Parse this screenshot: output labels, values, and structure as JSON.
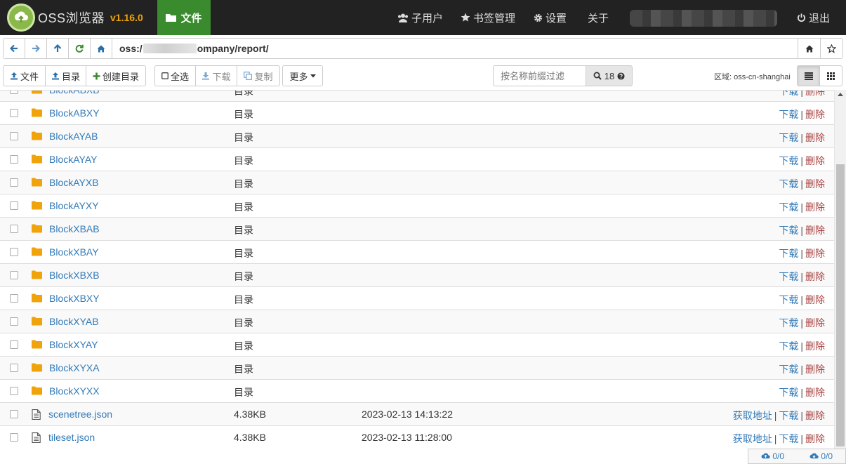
{
  "app": {
    "name": "OSS浏览器",
    "version": "v1.16.0"
  },
  "nav": {
    "files": "文件",
    "subusers": "子用户",
    "bookmarks": "书签管理",
    "settings": "设置",
    "about": "关于",
    "logout": "退出"
  },
  "address": {
    "prefix": "oss:/",
    "suffix": "ompany/report/"
  },
  "toolbar": {
    "upload_file": "文件",
    "upload_dir": "目录",
    "create_dir": "创建目录",
    "select_all": "全选",
    "download": "下载",
    "copy": "复制",
    "more": "更多",
    "filter_placeholder": "按名称前缀过滤",
    "count": "18",
    "region_label": "区域: oss-cn-shanghai"
  },
  "actions": {
    "get_url": "获取地址",
    "download": "下载",
    "delete": "删除"
  },
  "rows": [
    {
      "name": "BlockABXB",
      "kind": "dir",
      "type": "目录",
      "date": ""
    },
    {
      "name": "BlockABXY",
      "kind": "dir",
      "type": "目录",
      "date": ""
    },
    {
      "name": "BlockAYAB",
      "kind": "dir",
      "type": "目录",
      "date": ""
    },
    {
      "name": "BlockAYAY",
      "kind": "dir",
      "type": "目录",
      "date": ""
    },
    {
      "name": "BlockAYXB",
      "kind": "dir",
      "type": "目录",
      "date": ""
    },
    {
      "name": "BlockAYXY",
      "kind": "dir",
      "type": "目录",
      "date": ""
    },
    {
      "name": "BlockXBAB",
      "kind": "dir",
      "type": "目录",
      "date": ""
    },
    {
      "name": "BlockXBAY",
      "kind": "dir",
      "type": "目录",
      "date": ""
    },
    {
      "name": "BlockXBXB",
      "kind": "dir",
      "type": "目录",
      "date": ""
    },
    {
      "name": "BlockXBXY",
      "kind": "dir",
      "type": "目录",
      "date": ""
    },
    {
      "name": "BlockXYAB",
      "kind": "dir",
      "type": "目录",
      "date": ""
    },
    {
      "name": "BlockXYAY",
      "kind": "dir",
      "type": "目录",
      "date": ""
    },
    {
      "name": "BlockXYXA",
      "kind": "dir",
      "type": "目录",
      "date": ""
    },
    {
      "name": "BlockXYXX",
      "kind": "dir",
      "type": "目录",
      "date": ""
    },
    {
      "name": "scenetree.json",
      "kind": "file",
      "type": "4.38KB",
      "date": "2023-02-13 14:13:22"
    },
    {
      "name": "tileset.json",
      "kind": "file",
      "type": "4.38KB",
      "date": "2023-02-13 11:28:00"
    }
  ],
  "status": {
    "upload": "0/0",
    "download": "0/0"
  },
  "colors": {
    "navbar": "#222222",
    "active_tab": "#3a8a2e",
    "version": "#f0a30a",
    "folder": "#f0a30a",
    "link": "#337ab7",
    "delete": "#a94442"
  }
}
